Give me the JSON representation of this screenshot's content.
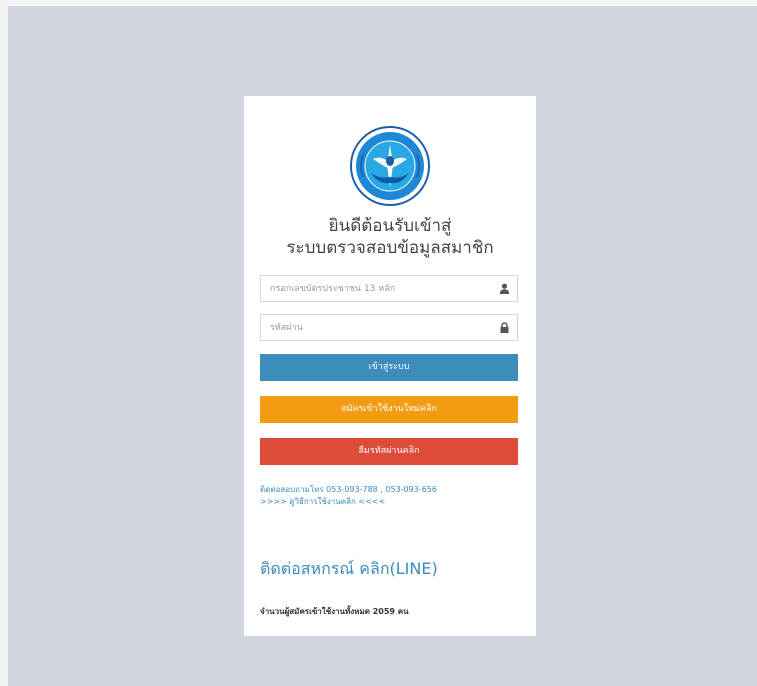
{
  "login": {
    "welcome_line1": "ยินดีต้อนรับเข้าสู่",
    "welcome_line2": "ระบบตรวจสอบข้อมูลสมาชิก",
    "id_placeholder": "กรอกเลขบัตรประชาชน 13 หลัก",
    "password_placeholder": "รหัสผ่าน",
    "login_label": "เข้าสู่ระบบ",
    "register_label": "สมัครเข้าใช้งานใหม่คลิก",
    "forgot_label": "ลืมรหัสผ่านคลิก",
    "contact_phone_text": "ติดต่อสอบถามโทร 053-093-788 , 053-093-656",
    "manual_link_text": ">>>> ดูวิธีการใช้งานคลิก <<<<",
    "contact_line_heading": "ติดต่อสหกรณ์ คลิก(LINE)",
    "member_count_text": "จำนวนผู้สมัครเข้าใช้งานทั้งหมด 2059 คน"
  },
  "icons": {
    "logo": "cooperative-logo",
    "id_field_icon": "user-icon",
    "password_field_icon": "lock-icon"
  },
  "colors": {
    "primary": "#3c8dbc",
    "warning": "#f39c12",
    "danger": "#dd4b39",
    "background": "#d2d6de"
  }
}
